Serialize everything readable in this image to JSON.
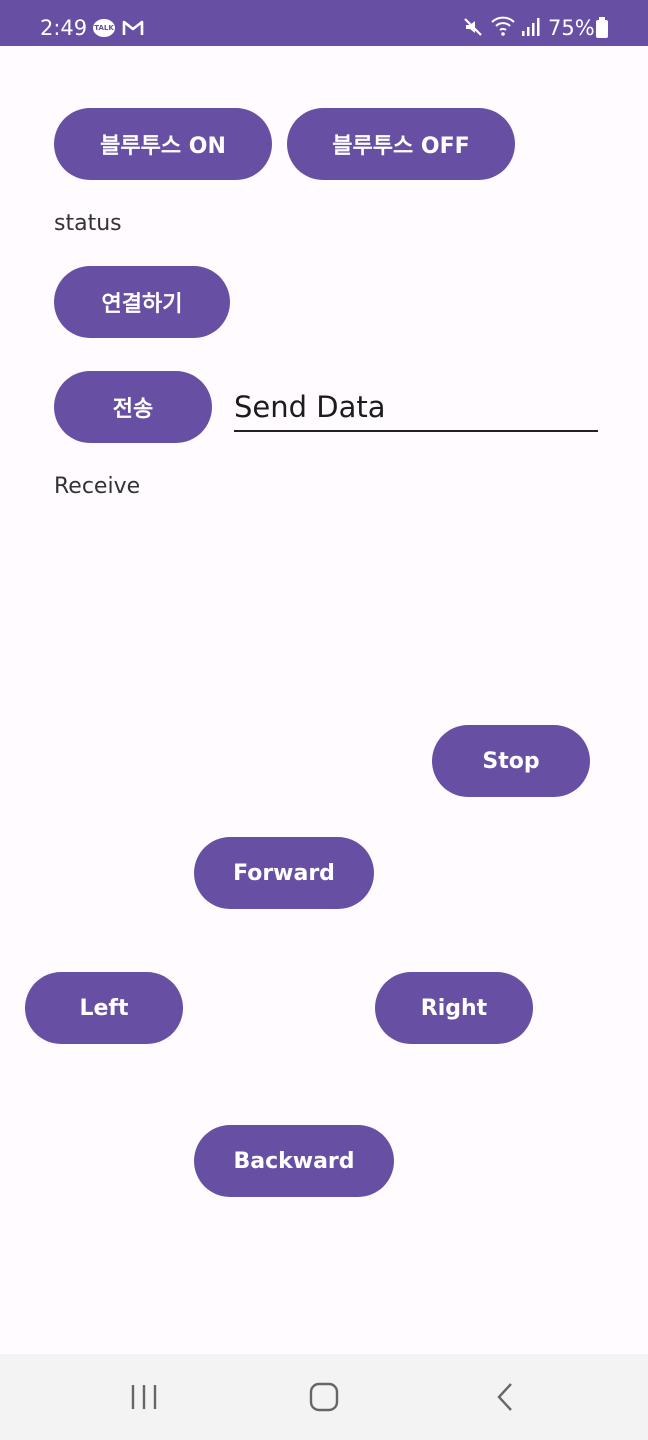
{
  "status_bar": {
    "time": "2:49",
    "talk_badge": "TALK",
    "battery": "75%",
    "icons": [
      "kakaotalk-icon",
      "gmail-icon",
      "mute-icon",
      "wifi-icon",
      "signal-icon",
      "battery-icon"
    ]
  },
  "buttons": {
    "bt_on": "블루투스 ON",
    "bt_off": "블루투스 OFF",
    "connect": "연결하기",
    "send": "전송",
    "stop": "Stop",
    "forward": "Forward",
    "left": "Left",
    "right": "Right",
    "backward": "Backward"
  },
  "labels": {
    "status": "status",
    "receive": "Receive"
  },
  "send_field": {
    "value": "",
    "placeholder": "Send Data"
  },
  "nav_bar": {
    "icons": [
      "recents-icon",
      "home-icon",
      "back-icon"
    ]
  },
  "colors": {
    "accent": "#6750a4",
    "background": "#fffbfe",
    "nav_background": "#f3f3f3"
  }
}
